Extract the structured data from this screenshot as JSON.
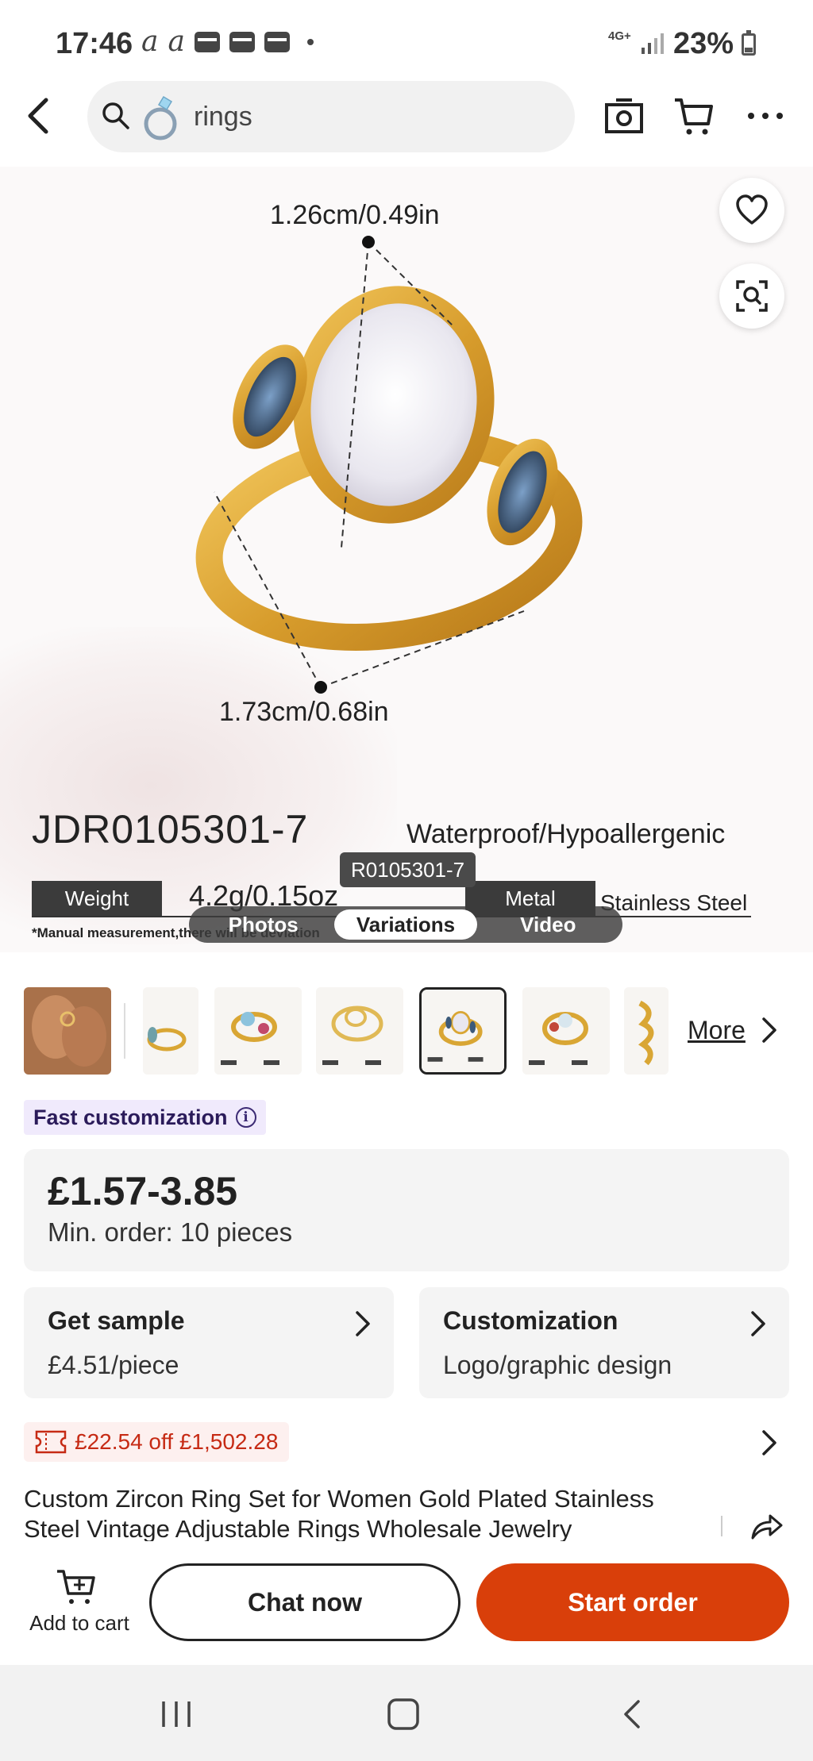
{
  "status_bar": {
    "time": "17:46",
    "network": "4G+",
    "battery": "23%"
  },
  "search": {
    "query": "rings"
  },
  "gallery": {
    "dimension_top": "1.26cm/0.49in",
    "dimension_bottom": "1.73cm/0.68in",
    "sku": "JDR0105301-7",
    "feature": "Waterproof/Hypoallergenic",
    "weight_label": "Weight",
    "weight_value": "4.2g/0.15oz",
    "metal_label": "Metal",
    "metal_value": "Stainless Steel",
    "note": "*Manual measurement,there will be deviation",
    "variant_tooltip": "R0105301-7",
    "media_tabs": [
      "Photos",
      "Variations",
      "Video"
    ],
    "active_tab": "Variations"
  },
  "thumbnails": {
    "more_label": "More"
  },
  "badge": {
    "label": "Fast customization"
  },
  "pricing": {
    "price": "£1.57-3.85",
    "min_order": "Min. order: 10 pieces"
  },
  "options": {
    "sample_title": "Get sample",
    "sample_value": "£4.51/piece",
    "custom_title": "Customization",
    "custom_value": "Logo/graphic design"
  },
  "coupon": {
    "text": "£22.54 off £1,502.28"
  },
  "product": {
    "title": "Custom Zircon Ring Set for Women Gold Plated Stainless Steel Vintage Adjustable Rings Wholesale Jewelry"
  },
  "actions": {
    "add_to_cart": "Add to cart",
    "chat": "Chat now",
    "start_order": "Start order"
  },
  "colors": {
    "accent": "#d93f0a",
    "coupon_red": "#c62a14",
    "badge_bg": "#f0eafc",
    "gold": "#d9a634"
  }
}
